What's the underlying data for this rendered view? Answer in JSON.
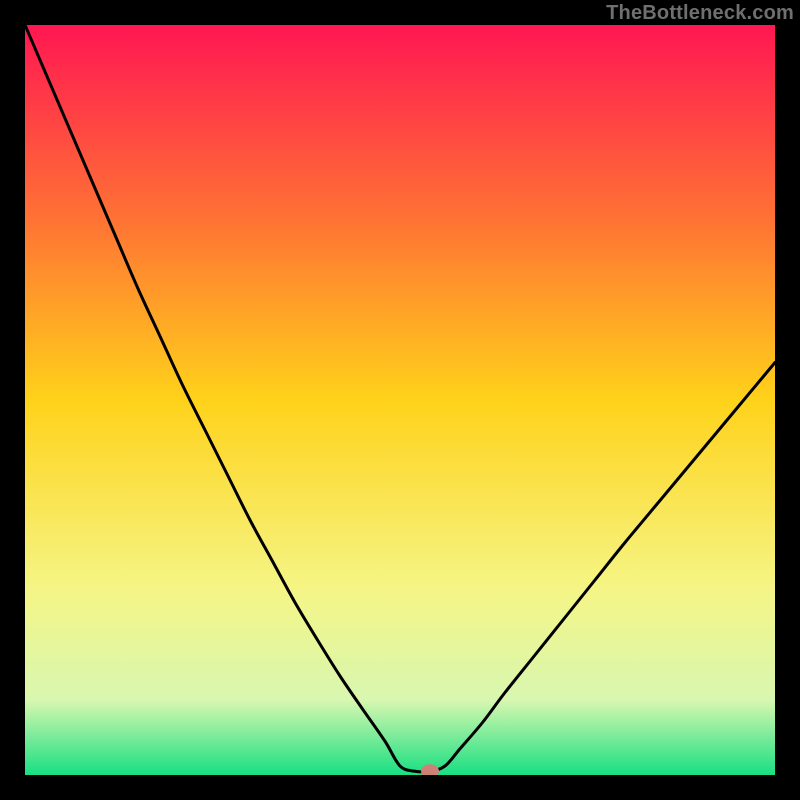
{
  "watermark": "TheBottleneck.com",
  "chart_data": {
    "type": "line",
    "title": "",
    "xlabel": "",
    "ylabel": "",
    "xlim": [
      0,
      100
    ],
    "ylim": [
      0,
      100
    ],
    "curve": {
      "x": [
        0,
        3,
        6,
        9,
        12,
        15,
        18,
        21,
        24,
        27,
        30,
        33,
        36,
        39,
        42,
        45,
        48,
        50,
        52,
        54,
        56,
        58,
        61,
        64,
        68,
        72,
        76,
        80,
        85,
        90,
        95,
        100
      ],
      "y": [
        100,
        93,
        86,
        79,
        72,
        65,
        58.5,
        52,
        46,
        40,
        34,
        28.5,
        23,
        18,
        13.2,
        8.8,
        4.5,
        1.2,
        0.5,
        0.5,
        1.2,
        3.5,
        7,
        11,
        16,
        21,
        26,
        31,
        37,
        43,
        49,
        55
      ]
    },
    "marker": {
      "x": 54,
      "y": 0.5,
      "color": "#cf8075"
    },
    "minimum_x": 54,
    "gradient_stops": [
      {
        "pos": 0.0,
        "color": "#ff1752"
      },
      {
        "pos": 0.25,
        "color": "#ff6f35"
      },
      {
        "pos": 0.5,
        "color": "#ffd21a"
      },
      {
        "pos": 0.75,
        "color": "#f5f585"
      },
      {
        "pos": 0.9,
        "color": "#d8f7b0"
      },
      {
        "pos": 1.0,
        "color": "#18df82"
      }
    ]
  }
}
